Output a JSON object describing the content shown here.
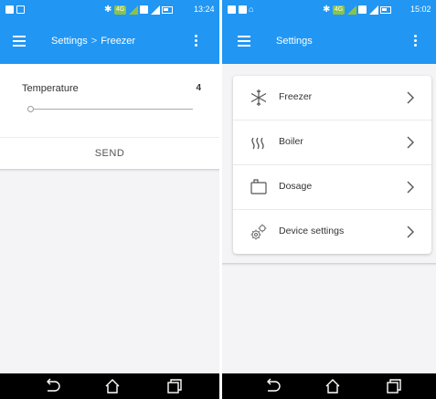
{
  "left": {
    "status_bar": {
      "time": "13:24",
      "network": "4G"
    },
    "app_bar": {
      "title_parent": "Settings",
      "separator": ">",
      "title_current": "Freezer"
    },
    "temperature": {
      "label": "Temperature",
      "value": "4",
      "slider_fraction": 0.0
    },
    "send_label": "SEND"
  },
  "right": {
    "status_bar": {
      "time": "15:02",
      "network": "4G"
    },
    "app_bar": {
      "title": "Settings"
    },
    "items": [
      {
        "label": "Freezer",
        "icon": "snowflake-icon"
      },
      {
        "label": "Boiler",
        "icon": "heat-waves-icon"
      },
      {
        "label": "Dosage",
        "icon": "dosage-box-icon"
      },
      {
        "label": "Device settings",
        "icon": "gears-icon"
      }
    ]
  },
  "colors": {
    "primary": "#2196f3",
    "background": "#f4f4f6",
    "nav_bar": "#000000"
  }
}
